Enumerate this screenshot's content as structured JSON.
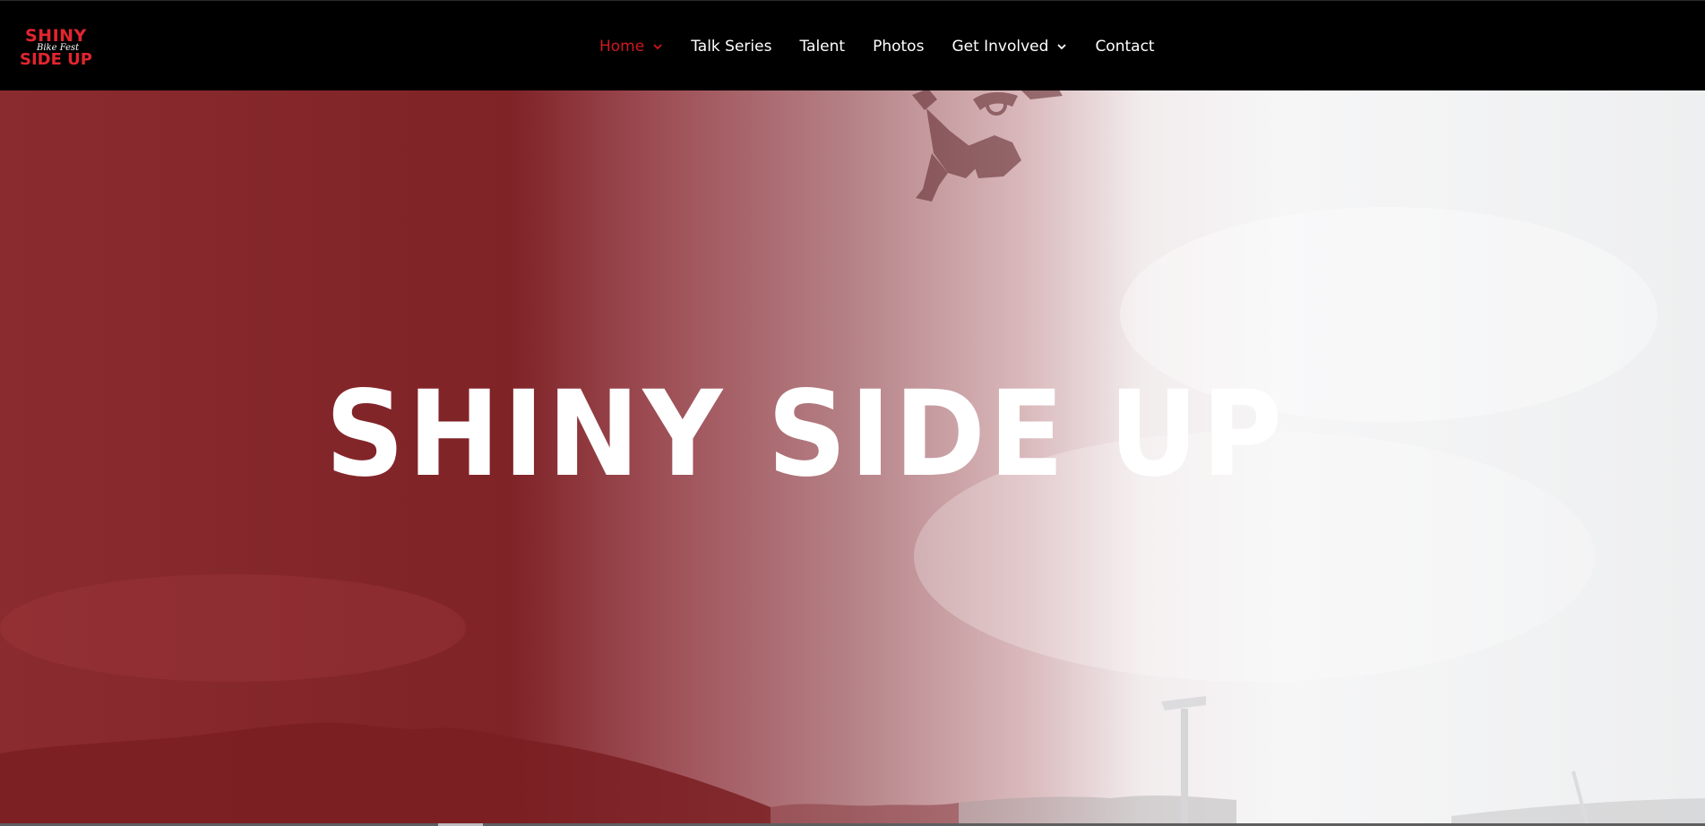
{
  "header": {
    "logo": {
      "icon": "shiny-side-up-logo",
      "line1": "SHINY",
      "script": "Bike Fest",
      "line2": "SIDE UP",
      "color": "#e2252f"
    },
    "nav": [
      {
        "label": "Home",
        "active": true,
        "has_dropdown": true
      },
      {
        "label": "Talk Series",
        "active": false,
        "has_dropdown": false
      },
      {
        "label": "Talent",
        "active": false,
        "has_dropdown": false
      },
      {
        "label": "Photos",
        "active": false,
        "has_dropdown": false
      },
      {
        "label": "Get Involved",
        "active": false,
        "has_dropdown": true
      },
      {
        "label": "Contact",
        "active": false,
        "has_dropdown": false
      }
    ],
    "active_color": "#d1171f"
  },
  "hero": {
    "title": "SHINY SIDE UP",
    "overlay_color": "#8a2b2f"
  }
}
